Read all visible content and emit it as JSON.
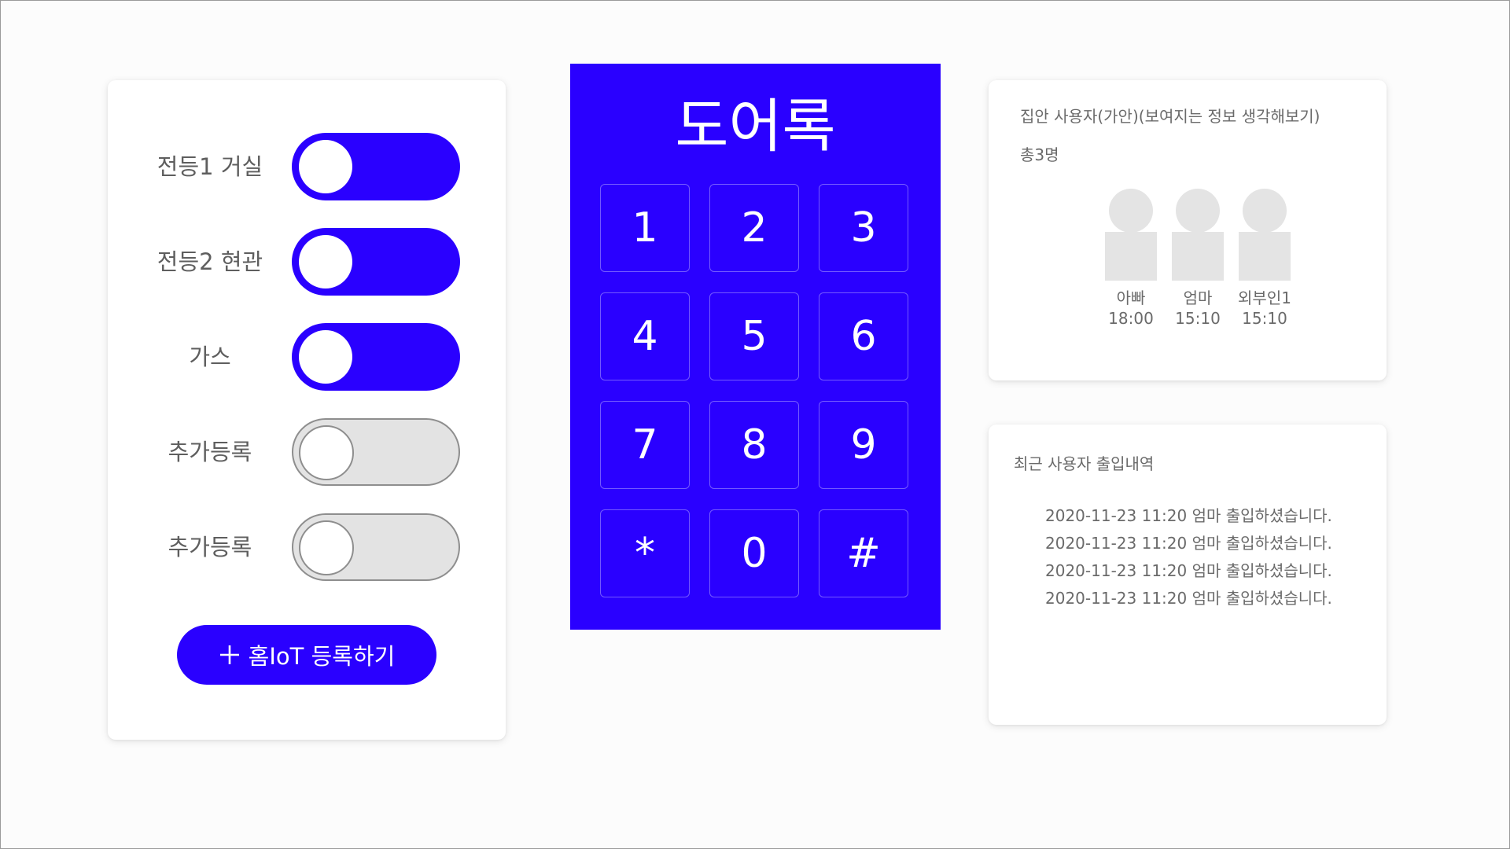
{
  "iot_panel": {
    "devices": [
      {
        "label": "전등1 거실",
        "state": "on"
      },
      {
        "label": "전등2 현관",
        "state": "on"
      },
      {
        "label": "가스",
        "state": "on"
      },
      {
        "label": "추가등록",
        "state": "off"
      },
      {
        "label": "추가등록",
        "state": "off"
      }
    ],
    "add_button_label": "홈IoT 등록하기",
    "add_button_icon": "plus-icon"
  },
  "door_lock": {
    "title": "도어록",
    "keys": [
      "1",
      "2",
      "3",
      "4",
      "5",
      "6",
      "7",
      "8",
      "9",
      "*",
      "0",
      "#"
    ]
  },
  "users_at_home": {
    "title": "집안 사용자(가안)(보여지는 정보 생각해보기)",
    "count_label": "총3명",
    "users": [
      {
        "name": "아빠",
        "time": "18:00"
      },
      {
        "name": "엄마",
        "time": "15:10"
      },
      {
        "name": "외부인1",
        "time": "15:10"
      }
    ]
  },
  "access_log": {
    "title": "최근 사용자 출입내역",
    "entries": [
      "2020-11-23 11:20 엄마 출입하셨습니다.",
      "2020-11-23 11:20 엄마 출입하셨습니다.",
      "2020-11-23 11:20 엄마 출입하셨습니다.",
      "2020-11-23 11:20 엄마 출입하셨습니다."
    ]
  },
  "colors": {
    "accent": "#2a00ff",
    "toggle_off": "#e3e3e3",
    "avatar_placeholder": "#e4e4e4",
    "background": "#fcfcfc"
  }
}
